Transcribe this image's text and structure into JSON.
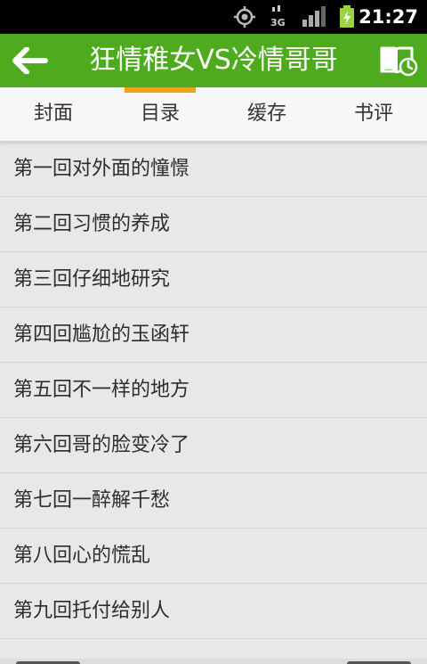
{
  "status_bar": {
    "time": "21:27",
    "icons": [
      "gps-icon",
      "3g-icon",
      "signal-icon",
      "battery-icon"
    ]
  },
  "action_bar": {
    "title": "狂情稚女VS冷情哥哥",
    "back_icon": "arrow-left-icon",
    "right_icon": "bookshelf-clock-icon"
  },
  "tabs": [
    {
      "label": "封面"
    },
    {
      "label": "目录"
    },
    {
      "label": "缓存"
    },
    {
      "label": "书评"
    }
  ],
  "selected_tab": "目录",
  "chapters": [
    {
      "title": "第一回对外面的憧憬"
    },
    {
      "title": "第二回习惯的养成"
    },
    {
      "title": "第三回仔细地研究"
    },
    {
      "title": "第四回尴尬的玉函轩"
    },
    {
      "title": "第五回不一样的地方"
    },
    {
      "title": "第六回哥的脸变冷了"
    },
    {
      "title": "第七回一醉解千愁"
    },
    {
      "title": "第八回心的慌乱"
    },
    {
      "title": "第九回托付给别人"
    }
  ],
  "colors": {
    "action_bar": "#4dab1d",
    "tab_indicator": "#e8a414",
    "list_background": "#e7e9e7"
  }
}
